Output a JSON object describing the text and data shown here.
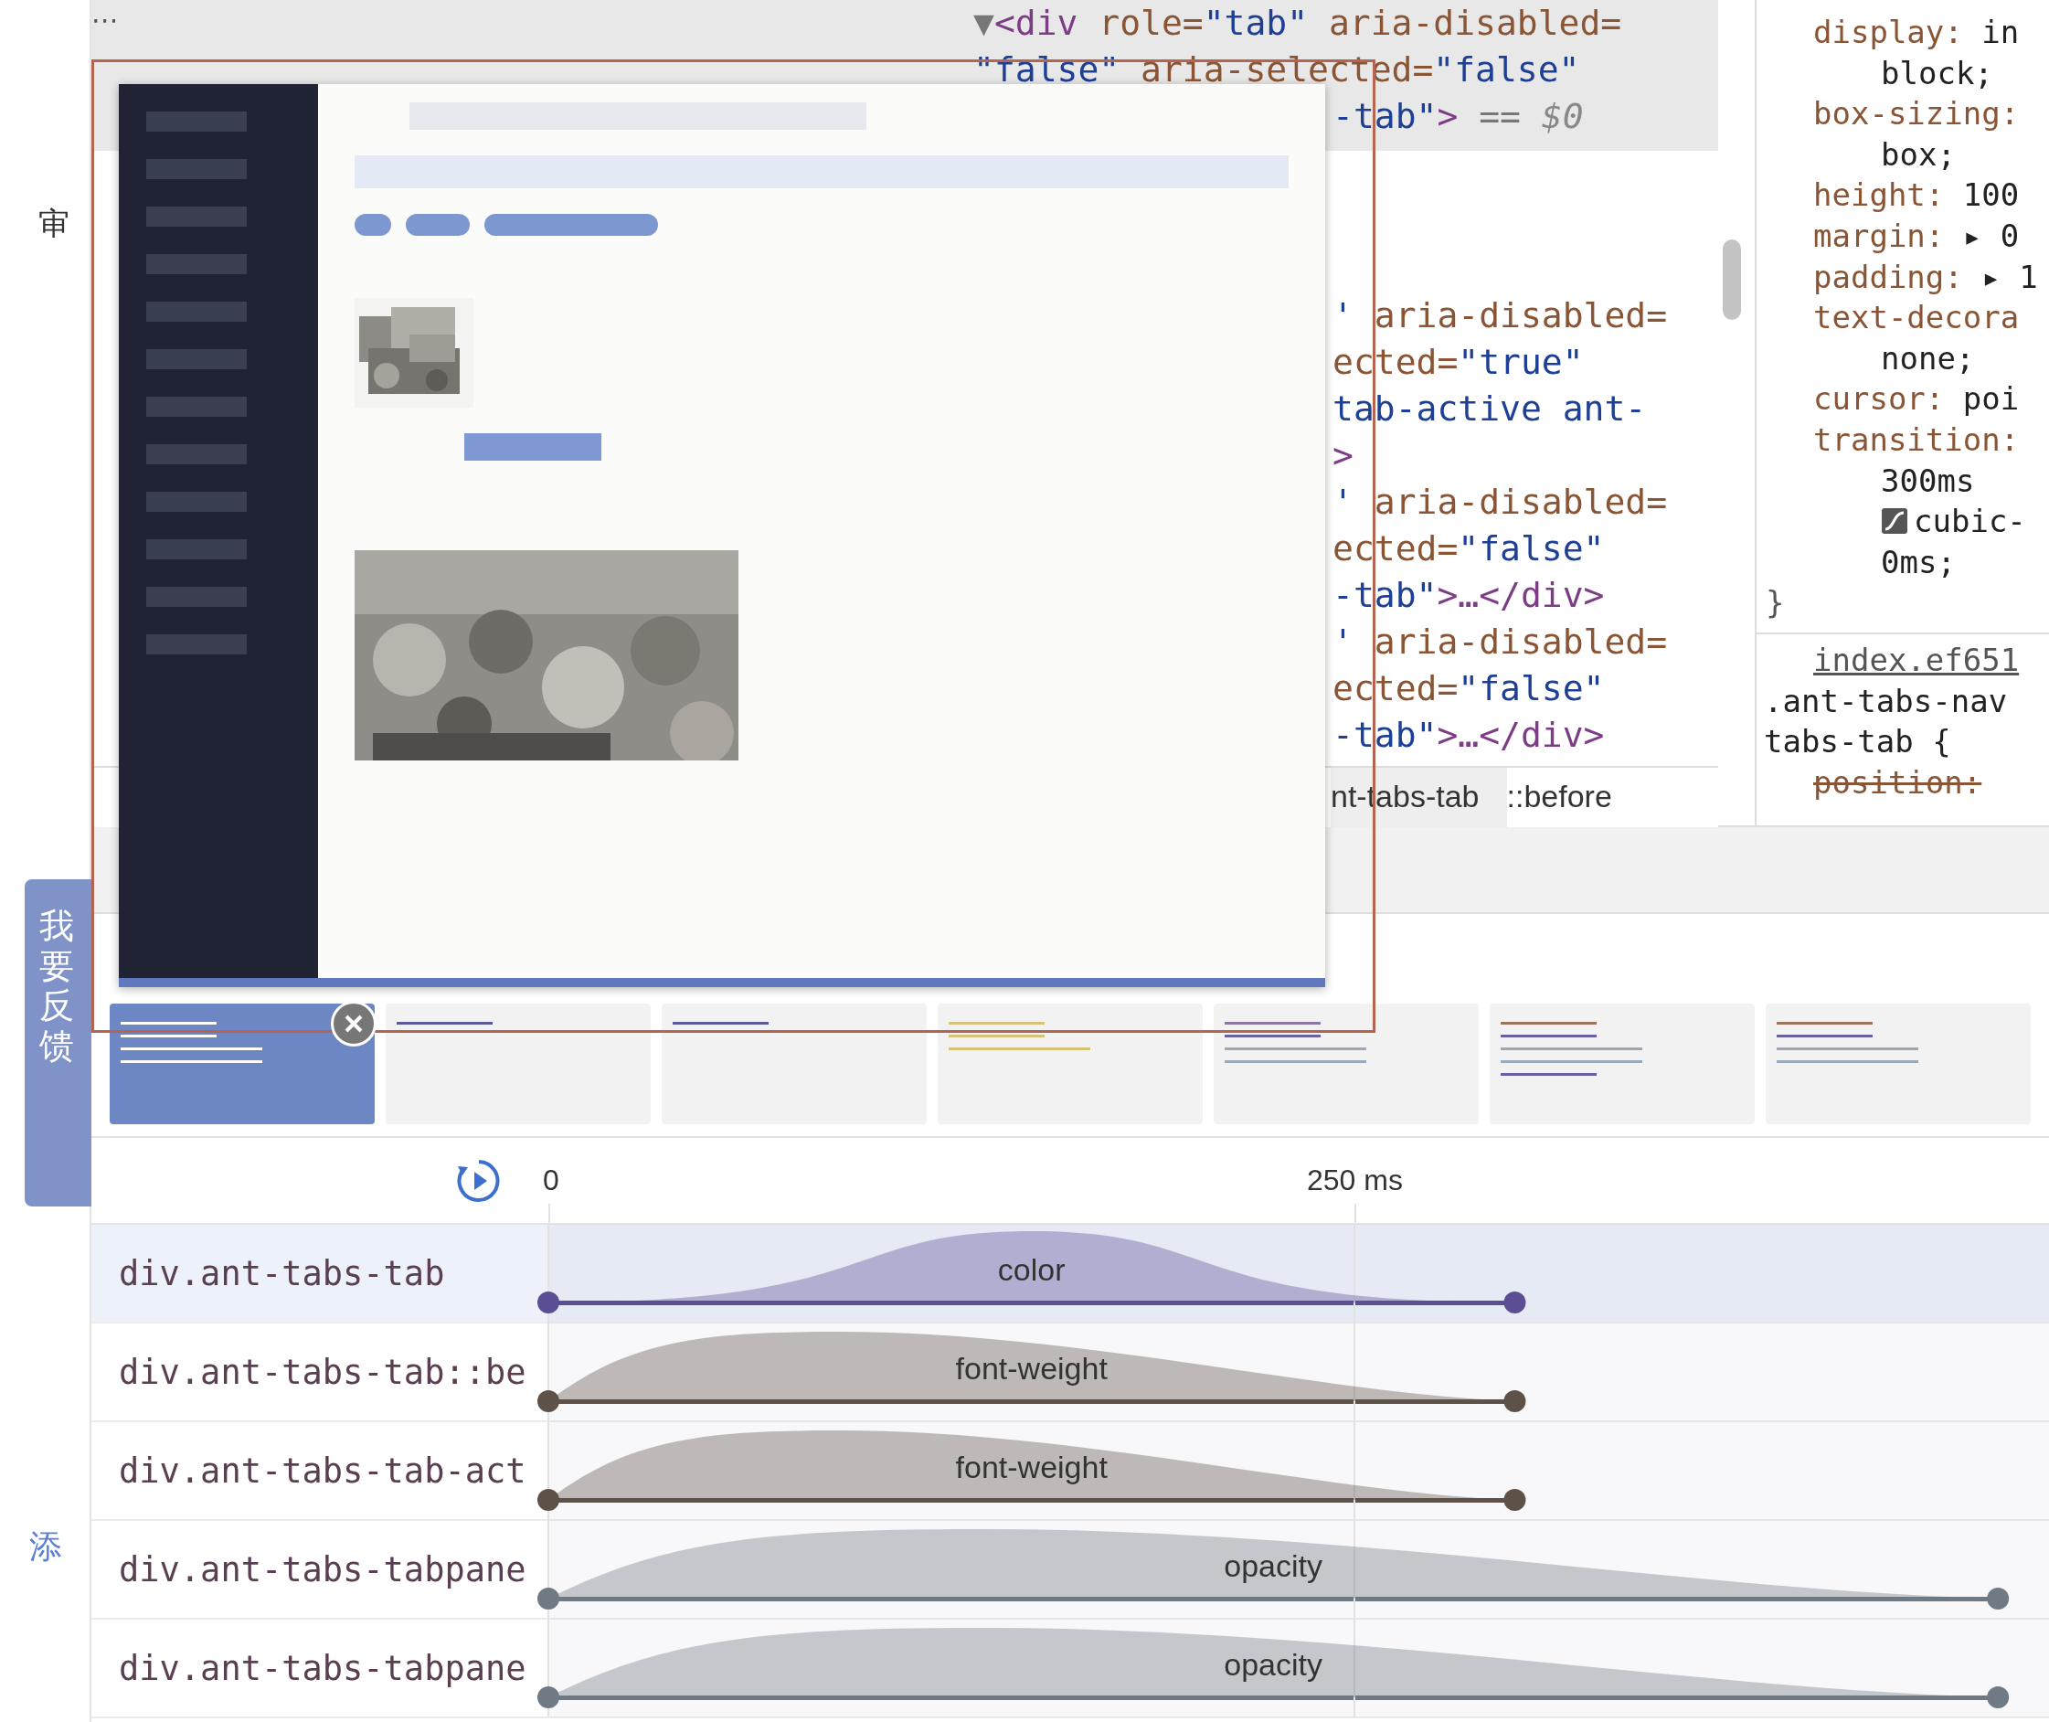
{
  "left_column": {
    "top_char": "审",
    "bottom_link": "添"
  },
  "feedback_tab": {
    "label": "我要反馈"
  },
  "elements": {
    "menu": "⋯",
    "selected_lines": [
      {
        "kind": "full",
        "segments": [
          {
            "kind": "plain",
            "text": "▼"
          },
          {
            "kind": "tag",
            "text": "<div"
          },
          {
            "kind": "attr",
            "text": " role="
          },
          {
            "kind": "value",
            "text": "\"tab\""
          },
          {
            "kind": "attr",
            "text": " aria-disabled="
          }
        ]
      },
      {
        "kind": "full",
        "segments": [
          {
            "kind": "value",
            "text": "\"false\""
          },
          {
            "kind": "attr",
            "text": " aria-selected="
          },
          {
            "kind": "value",
            "text": "\"false\""
          }
        ]
      },
      {
        "kind": "clipped",
        "segments": [
          {
            "kind": "value",
            "text": "-tab\""
          },
          {
            "kind": "tag",
            "text": ">"
          },
          {
            "kind": "plain",
            "text": " == "
          },
          {
            "kind": "var",
            "text": "$0"
          }
        ]
      }
    ],
    "lines": [
      {
        "kind": "clipped",
        "segments": [
          {
            "kind": "value",
            "text": "'"
          },
          {
            "kind": "attr",
            "text": " aria-disabled="
          }
        ]
      },
      {
        "kind": "clipped",
        "segments": [
          {
            "kind": "attr",
            "text": "ected="
          },
          {
            "kind": "value",
            "text": "\"true\""
          }
        ]
      },
      {
        "kind": "clipped",
        "segments": [
          {
            "kind": "value",
            "text": "tab-active ant-"
          }
        ]
      },
      {
        "kind": "clipped",
        "segments": [
          {
            "kind": "tag",
            "text": ">"
          }
        ]
      },
      {
        "kind": "clipped",
        "segments": [
          {
            "kind": "value",
            "text": "'"
          },
          {
            "kind": "attr",
            "text": " aria-disabled="
          }
        ]
      },
      {
        "kind": "clipped",
        "segments": [
          {
            "kind": "attr",
            "text": "ected="
          },
          {
            "kind": "value",
            "text": "\"false\""
          }
        ]
      },
      {
        "kind": "clipped",
        "segments": [
          {
            "kind": "value",
            "text": "-tab\""
          },
          {
            "kind": "tag",
            "text": ">…</div>"
          }
        ]
      },
      {
        "kind": "clipped",
        "segments": [
          {
            "kind": "value",
            "text": "'"
          },
          {
            "kind": "attr",
            "text": " aria-disabled="
          }
        ]
      },
      {
        "kind": "clipped",
        "segments": [
          {
            "kind": "attr",
            "text": "ected="
          },
          {
            "kind": "value",
            "text": "\"false\""
          }
        ]
      },
      {
        "kind": "clipped",
        "segments": [
          {
            "kind": "value",
            "text": "-tab\""
          },
          {
            "kind": "tag",
            "text": ">…</div>"
          }
        ]
      }
    ],
    "breadcrumbs": [
      {
        "label": "nt-tabs-tab",
        "selected": true
      },
      {
        "label": "::before",
        "selected": false
      }
    ]
  },
  "styles": {
    "lines": [
      {
        "kind": "decl",
        "name": "display:",
        "value": "in"
      },
      {
        "kind": "cont",
        "value": "block;"
      },
      {
        "kind": "decl",
        "name": "box-sizing:"
      },
      {
        "kind": "cont",
        "value": "box;"
      },
      {
        "kind": "decl",
        "name": "height:",
        "value": "100"
      },
      {
        "kind": "decl",
        "name": "margin:",
        "value": "▸ 0"
      },
      {
        "kind": "decl",
        "name": "padding:",
        "value": "▸ 1"
      },
      {
        "kind": "decl",
        "name": "text-decora"
      },
      {
        "kind": "cont",
        "value": "none;"
      },
      {
        "kind": "decl",
        "name": "cursor:",
        "value": "poi"
      },
      {
        "kind": "decl",
        "name": "transition:"
      },
      {
        "kind": "cont",
        "value": "300ms"
      },
      {
        "kind": "easing",
        "value": "cubic-"
      },
      {
        "kind": "cont",
        "value": "0ms;"
      },
      {
        "kind": "brace",
        "value": "}"
      }
    ],
    "source_link": "index.ef651",
    "selector_lines": [
      ".ant-tabs-nav",
      "tabs-tab {"
    ],
    "overridden": [
      {
        "name": "position:",
        "struck": true
      }
    ]
  },
  "animation_groups": [
    {
      "selected": true,
      "lines": [
        {
          "color": "#ffffff"
        },
        {
          "color": "#ffffff"
        },
        {
          "color": "#ffffff"
        },
        {
          "color": "#ffffff"
        }
      ]
    },
    {
      "selected": false,
      "lines": [
        {
          "color": "#5a5a9a"
        }
      ]
    },
    {
      "selected": false,
      "lines": [
        {
          "color": "#5a5a9a"
        }
      ]
    },
    {
      "selected": false,
      "lines": [
        {
          "color": "#d6c278"
        },
        {
          "color": "#d6c278"
        },
        {
          "color": "#d6c278"
        }
      ]
    },
    {
      "selected": false,
      "lines": [
        {
          "color": "#8b7a9c"
        },
        {
          "color": "#6a5fa0"
        },
        {
          "color": "#a0a6b0"
        },
        {
          "color": "#9aaabb"
        }
      ]
    },
    {
      "selected": false,
      "lines": [
        {
          "color": "#a0725e"
        },
        {
          "color": "#6a5fa0"
        },
        {
          "color": "#a0a6b0"
        },
        {
          "color": "#9aaabb"
        },
        {
          "color": "#6a5fa0"
        }
      ]
    },
    {
      "selected": false,
      "lines": [
        {
          "color": "#a0725e"
        },
        {
          "color": "#6a5fa0"
        },
        {
          "color": "#a0a6b0"
        },
        {
          "color": "#9aaabb"
        }
      ]
    }
  ],
  "timeline": {
    "ticks": [
      {
        "label": "0"
      },
      {
        "label": "250 ms"
      }
    ]
  },
  "animations": [
    {
      "target": "div.ant-tabs-tab",
      "property": "color",
      "selected": true,
      "kind": "bell",
      "level": 0.644,
      "color": "#5b4e95"
    },
    {
      "target": "div.ant-tabs-tab::be",
      "property": "font-weight",
      "selected": false,
      "kind": "decay",
      "level": 0.644,
      "color": "#5e5148"
    },
    {
      "target": "div.ant-tabs-tab-act",
      "property": "font-weight",
      "selected": false,
      "kind": "decay",
      "level": 0.644,
      "color": "#5e5148"
    },
    {
      "target": "div.ant-tabs-tabpane",
      "property": "opacity",
      "selected": false,
      "kind": "decay",
      "level": 0.966,
      "color": "#6f7a84"
    },
    {
      "target": "div.ant-tabs-tabpane",
      "property": "opacity",
      "selected": false,
      "kind": "decay",
      "level": 0.966,
      "color": "#6f7a84"
    }
  ]
}
